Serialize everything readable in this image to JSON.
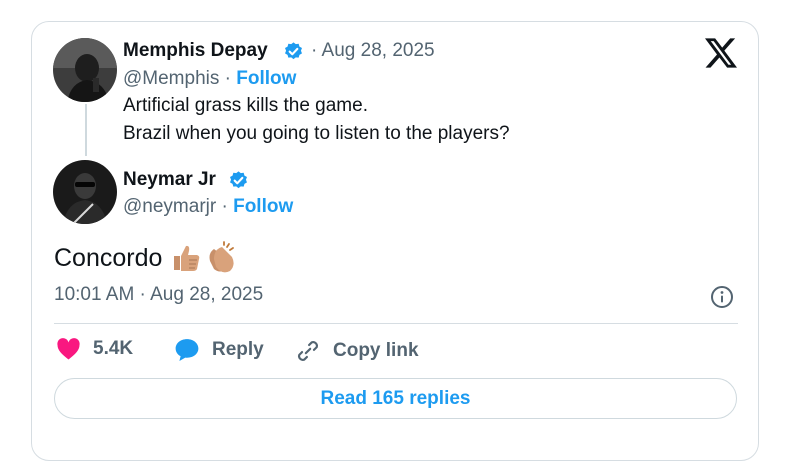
{
  "quoted_tweet": {
    "author_name": "Memphis Depay",
    "date": "· Aug 28, 2025",
    "handle": "@Memphis",
    "follow_label": "Follow",
    "text_line1": "Artificial grass kills the game.",
    "text_line2": "Brazil when you going to listen to the players?"
  },
  "tweet": {
    "author_name": "Neymar Jr",
    "handle": "@neymarjr",
    "follow_label": "Follow",
    "text": "Concordo",
    "emojis": [
      "thumbs-up",
      "clapping-hands"
    ],
    "timestamp": "10:01 AM · Aug 28, 2025"
  },
  "actions": {
    "likes_count": "5.4K",
    "reply_label": "Reply",
    "copy_link_label": "Copy link"
  },
  "read_replies_label": "Read 165 replies",
  "colors": {
    "accent": "#1d9bf0",
    "like": "#f91880",
    "text": "#0f1419",
    "secondary": "#536471"
  }
}
